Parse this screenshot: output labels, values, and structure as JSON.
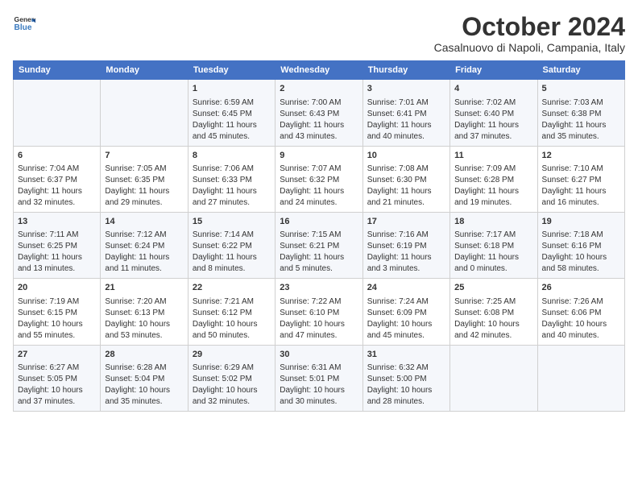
{
  "header": {
    "logo_line1": "General",
    "logo_line2": "Blue",
    "month": "October 2024",
    "location": "Casalnuovo di Napoli, Campania, Italy"
  },
  "weekdays": [
    "Sunday",
    "Monday",
    "Tuesday",
    "Wednesday",
    "Thursday",
    "Friday",
    "Saturday"
  ],
  "weeks": [
    [
      {
        "day": "",
        "sunrise": "",
        "sunset": "",
        "daylight": ""
      },
      {
        "day": "",
        "sunrise": "",
        "sunset": "",
        "daylight": ""
      },
      {
        "day": "1",
        "sunrise": "Sunrise: 6:59 AM",
        "sunset": "Sunset: 6:45 PM",
        "daylight": "Daylight: 11 hours and 45 minutes."
      },
      {
        "day": "2",
        "sunrise": "Sunrise: 7:00 AM",
        "sunset": "Sunset: 6:43 PM",
        "daylight": "Daylight: 11 hours and 43 minutes."
      },
      {
        "day": "3",
        "sunrise": "Sunrise: 7:01 AM",
        "sunset": "Sunset: 6:41 PM",
        "daylight": "Daylight: 11 hours and 40 minutes."
      },
      {
        "day": "4",
        "sunrise": "Sunrise: 7:02 AM",
        "sunset": "Sunset: 6:40 PM",
        "daylight": "Daylight: 11 hours and 37 minutes."
      },
      {
        "day": "5",
        "sunrise": "Sunrise: 7:03 AM",
        "sunset": "Sunset: 6:38 PM",
        "daylight": "Daylight: 11 hours and 35 minutes."
      }
    ],
    [
      {
        "day": "6",
        "sunrise": "Sunrise: 7:04 AM",
        "sunset": "Sunset: 6:37 PM",
        "daylight": "Daylight: 11 hours and 32 minutes."
      },
      {
        "day": "7",
        "sunrise": "Sunrise: 7:05 AM",
        "sunset": "Sunset: 6:35 PM",
        "daylight": "Daylight: 11 hours and 29 minutes."
      },
      {
        "day": "8",
        "sunrise": "Sunrise: 7:06 AM",
        "sunset": "Sunset: 6:33 PM",
        "daylight": "Daylight: 11 hours and 27 minutes."
      },
      {
        "day": "9",
        "sunrise": "Sunrise: 7:07 AM",
        "sunset": "Sunset: 6:32 PM",
        "daylight": "Daylight: 11 hours and 24 minutes."
      },
      {
        "day": "10",
        "sunrise": "Sunrise: 7:08 AM",
        "sunset": "Sunset: 6:30 PM",
        "daylight": "Daylight: 11 hours and 21 minutes."
      },
      {
        "day": "11",
        "sunrise": "Sunrise: 7:09 AM",
        "sunset": "Sunset: 6:28 PM",
        "daylight": "Daylight: 11 hours and 19 minutes."
      },
      {
        "day": "12",
        "sunrise": "Sunrise: 7:10 AM",
        "sunset": "Sunset: 6:27 PM",
        "daylight": "Daylight: 11 hours and 16 minutes."
      }
    ],
    [
      {
        "day": "13",
        "sunrise": "Sunrise: 7:11 AM",
        "sunset": "Sunset: 6:25 PM",
        "daylight": "Daylight: 11 hours and 13 minutes."
      },
      {
        "day": "14",
        "sunrise": "Sunrise: 7:12 AM",
        "sunset": "Sunset: 6:24 PM",
        "daylight": "Daylight: 11 hours and 11 minutes."
      },
      {
        "day": "15",
        "sunrise": "Sunrise: 7:14 AM",
        "sunset": "Sunset: 6:22 PM",
        "daylight": "Daylight: 11 hours and 8 minutes."
      },
      {
        "day": "16",
        "sunrise": "Sunrise: 7:15 AM",
        "sunset": "Sunset: 6:21 PM",
        "daylight": "Daylight: 11 hours and 5 minutes."
      },
      {
        "day": "17",
        "sunrise": "Sunrise: 7:16 AM",
        "sunset": "Sunset: 6:19 PM",
        "daylight": "Daylight: 11 hours and 3 minutes."
      },
      {
        "day": "18",
        "sunrise": "Sunrise: 7:17 AM",
        "sunset": "Sunset: 6:18 PM",
        "daylight": "Daylight: 11 hours and 0 minutes."
      },
      {
        "day": "19",
        "sunrise": "Sunrise: 7:18 AM",
        "sunset": "Sunset: 6:16 PM",
        "daylight": "Daylight: 10 hours and 58 minutes."
      }
    ],
    [
      {
        "day": "20",
        "sunrise": "Sunrise: 7:19 AM",
        "sunset": "Sunset: 6:15 PM",
        "daylight": "Daylight: 10 hours and 55 minutes."
      },
      {
        "day": "21",
        "sunrise": "Sunrise: 7:20 AM",
        "sunset": "Sunset: 6:13 PM",
        "daylight": "Daylight: 10 hours and 53 minutes."
      },
      {
        "day": "22",
        "sunrise": "Sunrise: 7:21 AM",
        "sunset": "Sunset: 6:12 PM",
        "daylight": "Daylight: 10 hours and 50 minutes."
      },
      {
        "day": "23",
        "sunrise": "Sunrise: 7:22 AM",
        "sunset": "Sunset: 6:10 PM",
        "daylight": "Daylight: 10 hours and 47 minutes."
      },
      {
        "day": "24",
        "sunrise": "Sunrise: 7:24 AM",
        "sunset": "Sunset: 6:09 PM",
        "daylight": "Daylight: 10 hours and 45 minutes."
      },
      {
        "day": "25",
        "sunrise": "Sunrise: 7:25 AM",
        "sunset": "Sunset: 6:08 PM",
        "daylight": "Daylight: 10 hours and 42 minutes."
      },
      {
        "day": "26",
        "sunrise": "Sunrise: 7:26 AM",
        "sunset": "Sunset: 6:06 PM",
        "daylight": "Daylight: 10 hours and 40 minutes."
      }
    ],
    [
      {
        "day": "27",
        "sunrise": "Sunrise: 6:27 AM",
        "sunset": "Sunset: 5:05 PM",
        "daylight": "Daylight: 10 hours and 37 minutes."
      },
      {
        "day": "28",
        "sunrise": "Sunrise: 6:28 AM",
        "sunset": "Sunset: 5:04 PM",
        "daylight": "Daylight: 10 hours and 35 minutes."
      },
      {
        "day": "29",
        "sunrise": "Sunrise: 6:29 AM",
        "sunset": "Sunset: 5:02 PM",
        "daylight": "Daylight: 10 hours and 32 minutes."
      },
      {
        "day": "30",
        "sunrise": "Sunrise: 6:31 AM",
        "sunset": "Sunset: 5:01 PM",
        "daylight": "Daylight: 10 hours and 30 minutes."
      },
      {
        "day": "31",
        "sunrise": "Sunrise: 6:32 AM",
        "sunset": "Sunset: 5:00 PM",
        "daylight": "Daylight: 10 hours and 28 minutes."
      },
      {
        "day": "",
        "sunrise": "",
        "sunset": "",
        "daylight": ""
      },
      {
        "day": "",
        "sunrise": "",
        "sunset": "",
        "daylight": ""
      }
    ]
  ]
}
